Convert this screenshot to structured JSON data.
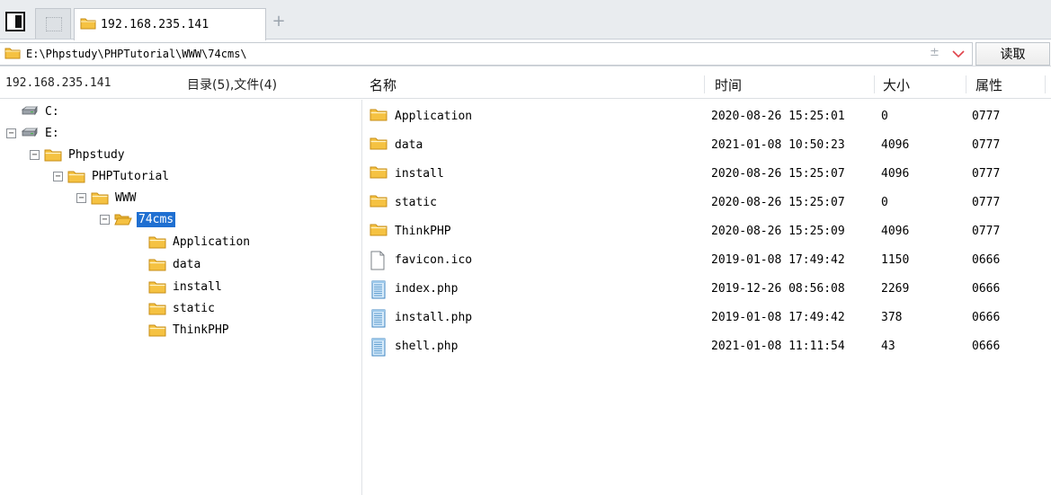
{
  "tabs": [
    {
      "label": "192.168.235.141",
      "icon": "folder-icon",
      "active": true
    }
  ],
  "path": {
    "value": "E:\\Phpstudy\\PHPTutorial\\WWW\\74cms\\",
    "plusminus": "±",
    "read_label": "读取"
  },
  "left_header": {
    "host": "192.168.235.141",
    "counts": "目录(5),文件(4)"
  },
  "columns": {
    "name": "名称",
    "time": "时间",
    "size": "大小",
    "perm": "属性"
  },
  "tree": [
    {
      "label": "C:",
      "type": "drive",
      "level": 0,
      "toggle": ""
    },
    {
      "label": "E:",
      "type": "drive",
      "level": 0,
      "toggle": "−"
    },
    {
      "label": "Phpstudy",
      "type": "folder",
      "level": 1,
      "toggle": "−"
    },
    {
      "label": "PHPTutorial",
      "type": "folder",
      "level": 2,
      "toggle": "−"
    },
    {
      "label": "WWW",
      "type": "folder",
      "level": 3,
      "toggle": "−"
    },
    {
      "label": "74cms",
      "type": "folder-open",
      "level": 4,
      "toggle": "−",
      "selected": true
    },
    {
      "label": "Application",
      "type": "folder",
      "level": 5,
      "toggle": ""
    },
    {
      "label": "data",
      "type": "folder",
      "level": 5,
      "toggle": ""
    },
    {
      "label": "install",
      "type": "folder",
      "level": 5,
      "toggle": ""
    },
    {
      "label": "static",
      "type": "folder",
      "level": 5,
      "toggle": ""
    },
    {
      "label": "ThinkPHP",
      "type": "folder",
      "level": 5,
      "toggle": ""
    }
  ],
  "files": [
    {
      "name": "Application",
      "type": "folder",
      "time": "2020-08-26 15:25:01",
      "size": "0",
      "perm": "0777"
    },
    {
      "name": "data",
      "type": "folder",
      "time": "2021-01-08 10:50:23",
      "size": "4096",
      "perm": "0777"
    },
    {
      "name": "install",
      "type": "folder",
      "time": "2020-08-26 15:25:07",
      "size": "4096",
      "perm": "0777"
    },
    {
      "name": "static",
      "type": "folder",
      "time": "2020-08-26 15:25:07",
      "size": "0",
      "perm": "0777"
    },
    {
      "name": "ThinkPHP",
      "type": "folder",
      "time": "2020-08-26 15:25:09",
      "size": "4096",
      "perm": "0777"
    },
    {
      "name": "favicon.ico",
      "type": "file-blank",
      "time": "2019-01-08 17:49:42",
      "size": "1150",
      "perm": "0666"
    },
    {
      "name": "index.php",
      "type": "file-text",
      "time": "2019-12-26 08:56:08",
      "size": "2269",
      "perm": "0666"
    },
    {
      "name": "install.php",
      "type": "file-text",
      "time": "2019-01-08 17:49:42",
      "size": "378",
      "perm": "0666"
    },
    {
      "name": "shell.php",
      "type": "file-text",
      "time": "2021-01-08 11:11:54",
      "size": "43",
      "perm": "0666"
    }
  ],
  "colors": {
    "folder": "#f5c242",
    "folder_edge": "#c78e16",
    "selection": "#1f6fd1",
    "chevron": "#e0434b"
  }
}
